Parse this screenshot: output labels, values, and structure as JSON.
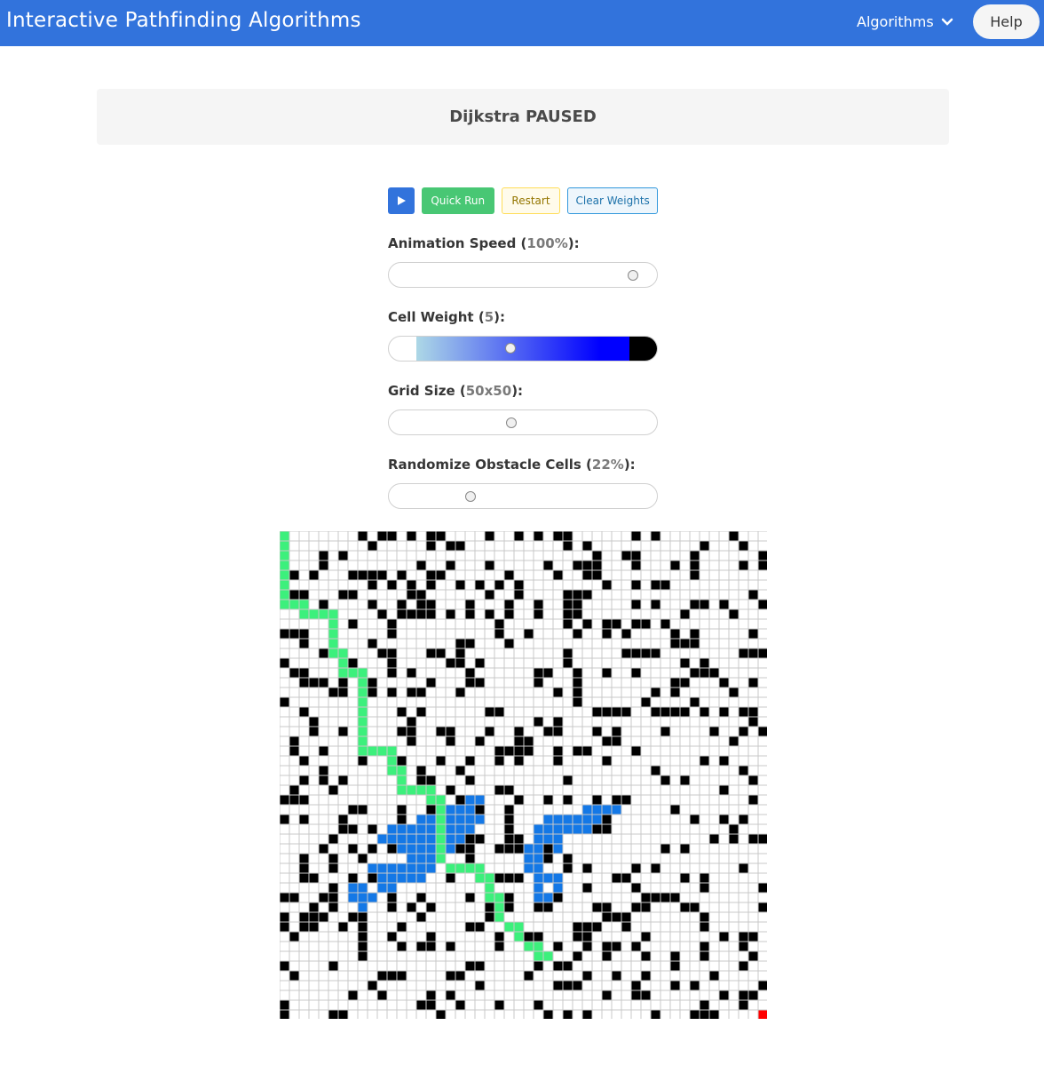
{
  "nav": {
    "title": "Interactive Pathfinding Algorithms",
    "algorithms_label": "Algorithms",
    "help_label": "Help"
  },
  "status": {
    "text": "Dijkstra PAUSED"
  },
  "buttons": {
    "quick_run": "Quick Run",
    "restart": "Restart",
    "clear_weights": "Clear Weights"
  },
  "controls": {
    "speed": {
      "label": "Animation Speed",
      "value": "100%",
      "fraction": 0.95
    },
    "weight": {
      "label": "Cell Weight",
      "value": "5",
      "fraction": 0.45
    },
    "size": {
      "label": "Grid Size",
      "value": "50x50",
      "fraction": 0.45
    },
    "obstacles": {
      "label": "Randomize Obstacle Cells",
      "value": "22%",
      "fraction": 0.28
    }
  },
  "grid": {
    "cols": 50,
    "rows": 50,
    "colors": {
      "wall": "#000000",
      "empty": "#ffffff",
      "line": "#c8c8c8",
      "path": "#3cf07c",
      "visited": "#1478e6",
      "end": "#ff0000"
    },
    "end": [
      49,
      49
    ],
    "path": [
      [
        0,
        0
      ],
      [
        0,
        1
      ],
      [
        0,
        2
      ],
      [
        0,
        3
      ],
      [
        0,
        4
      ],
      [
        0,
        5
      ],
      [
        0,
        6
      ],
      [
        0,
        7
      ],
      [
        1,
        7
      ],
      [
        2,
        7
      ],
      [
        2,
        8
      ],
      [
        3,
        8
      ],
      [
        4,
        8
      ],
      [
        5,
        8
      ],
      [
        5,
        9
      ],
      [
        5,
        10
      ],
      [
        5,
        11
      ],
      [
        5,
        12
      ],
      [
        6,
        12
      ],
      [
        6,
        13
      ],
      [
        6,
        14
      ],
      [
        7,
        14
      ],
      [
        8,
        14
      ],
      [
        8,
        15
      ],
      [
        8,
        16
      ],
      [
        8,
        17
      ],
      [
        8,
        18
      ],
      [
        8,
        19
      ],
      [
        8,
        20
      ],
      [
        8,
        21
      ],
      [
        8,
        22
      ],
      [
        9,
        22
      ],
      [
        10,
        22
      ],
      [
        11,
        22
      ],
      [
        11,
        23
      ],
      [
        11,
        24
      ],
      [
        12,
        24
      ],
      [
        12,
        25
      ],
      [
        12,
        26
      ],
      [
        13,
        26
      ],
      [
        14,
        26
      ],
      [
        15,
        26
      ],
      [
        15,
        27
      ],
      [
        16,
        27
      ],
      [
        16,
        28
      ],
      [
        16,
        29
      ],
      [
        16,
        30
      ],
      [
        16,
        31
      ],
      [
        16,
        32
      ],
      [
        16,
        33
      ],
      [
        17,
        34
      ],
      [
        18,
        34
      ],
      [
        19,
        34
      ],
      [
        20,
        34
      ],
      [
        20,
        35
      ],
      [
        21,
        35
      ],
      [
        21,
        36
      ],
      [
        21,
        37
      ],
      [
        22,
        37
      ],
      [
        22,
        38
      ],
      [
        22,
        39
      ],
      [
        23,
        40
      ],
      [
        24,
        40
      ],
      [
        24,
        41
      ],
      [
        25,
        42
      ],
      [
        26,
        42
      ],
      [
        26,
        43
      ],
      [
        27,
        43
      ]
    ],
    "visited": [
      [
        19,
        27
      ],
      [
        20,
        27
      ],
      [
        19,
        28
      ],
      [
        17,
        28
      ],
      [
        18,
        28
      ],
      [
        18,
        29
      ],
      [
        14,
        29
      ],
      [
        15,
        29
      ],
      [
        17,
        29
      ],
      [
        18,
        29
      ],
      [
        19,
        29
      ],
      [
        20,
        29
      ],
      [
        11,
        30
      ],
      [
        12,
        30
      ],
      [
        13,
        30
      ],
      [
        14,
        30
      ],
      [
        15,
        30
      ],
      [
        17,
        30
      ],
      [
        18,
        30
      ],
      [
        19,
        30
      ],
      [
        10,
        31
      ],
      [
        11,
        31
      ],
      [
        12,
        31
      ],
      [
        13,
        31
      ],
      [
        14,
        31
      ],
      [
        15,
        31
      ],
      [
        17,
        31
      ],
      [
        18,
        31
      ],
      [
        12,
        32
      ],
      [
        13,
        32
      ],
      [
        14,
        32
      ],
      [
        15,
        32
      ],
      [
        17,
        32
      ],
      [
        13,
        33
      ],
      [
        14,
        33
      ],
      [
        15,
        33
      ],
      [
        9,
        34
      ],
      [
        10,
        34
      ],
      [
        11,
        34
      ],
      [
        12,
        34
      ],
      [
        13,
        34
      ],
      [
        14,
        34
      ],
      [
        15,
        34
      ],
      [
        10,
        35
      ],
      [
        11,
        35
      ],
      [
        12,
        35
      ],
      [
        13,
        35
      ],
      [
        14,
        35
      ],
      [
        7,
        36
      ],
      [
        8,
        36
      ],
      [
        10,
        36
      ],
      [
        11,
        36
      ],
      [
        7,
        37
      ],
      [
        8,
        37
      ],
      [
        9,
        37
      ],
      [
        8,
        38
      ],
      [
        31,
        28
      ],
      [
        32,
        28
      ],
      [
        33,
        28
      ],
      [
        34,
        28
      ],
      [
        27,
        29
      ],
      [
        28,
        29
      ],
      [
        29,
        29
      ],
      [
        30,
        29
      ],
      [
        31,
        29
      ],
      [
        32,
        29
      ],
      [
        26,
        30
      ],
      [
        27,
        30
      ],
      [
        28,
        30
      ],
      [
        29,
        30
      ],
      [
        30,
        30
      ],
      [
        31,
        30
      ],
      [
        26,
        31
      ],
      [
        27,
        31
      ],
      [
        28,
        31
      ],
      [
        25,
        32
      ],
      [
        26,
        32
      ],
      [
        28,
        32
      ],
      [
        25,
        33
      ],
      [
        26,
        33
      ],
      [
        25,
        34
      ],
      [
        26,
        34
      ],
      [
        26,
        35
      ],
      [
        27,
        35
      ],
      [
        28,
        35
      ],
      [
        26,
        36
      ],
      [
        28,
        36
      ],
      [
        26,
        37
      ],
      [
        27,
        37
      ]
    ],
    "wall_density": 0.22,
    "seed": 7
  }
}
